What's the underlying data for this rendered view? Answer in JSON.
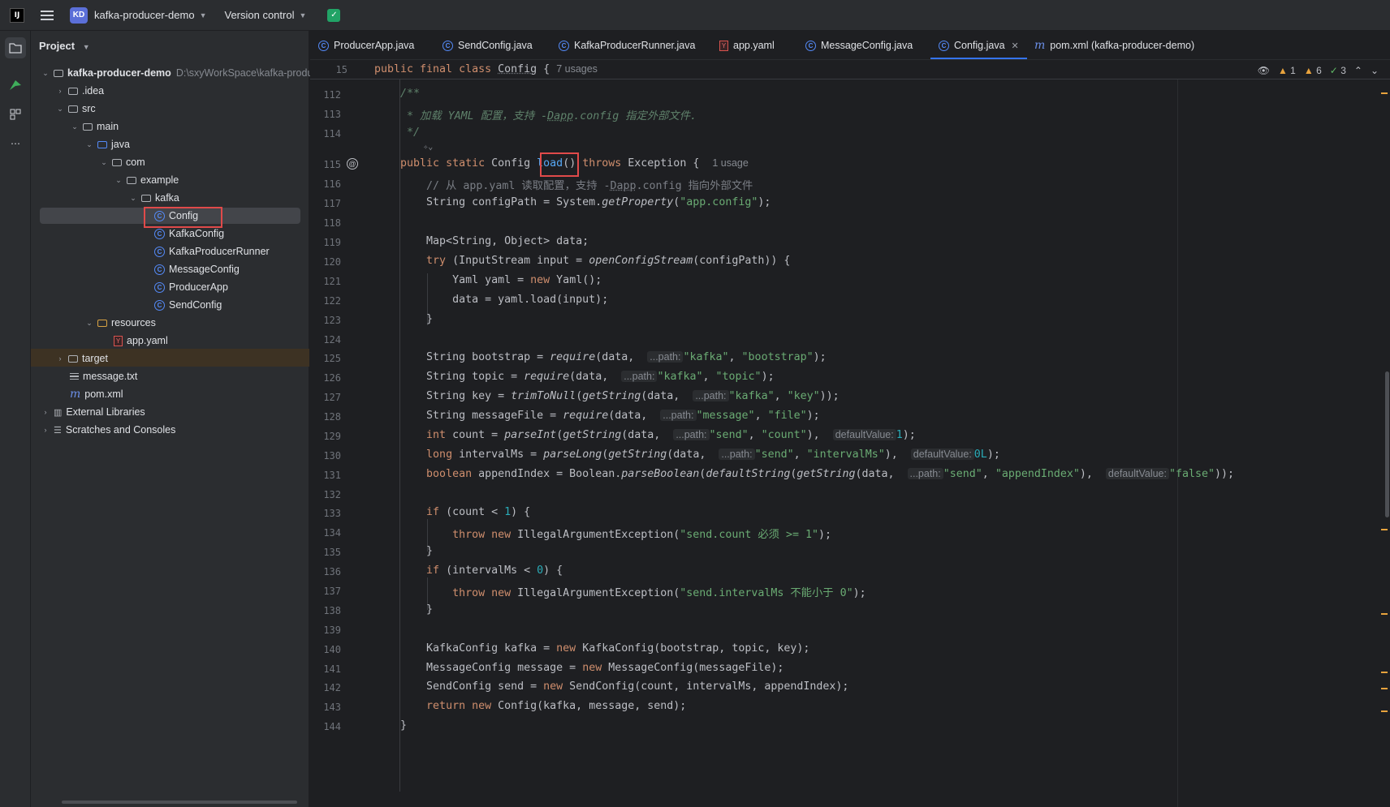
{
  "titlebar": {
    "logo": "IJ",
    "project_badge": "KD",
    "project_name": "kafka-producer-demo",
    "vcs_label": "Version control"
  },
  "project_panel": {
    "title": "Project",
    "root_name": "kafka-producer-demo",
    "root_path": "D:\\sxyWorkSpace\\kafka-produc",
    "items": {
      "idea": ".idea",
      "src": "src",
      "main": "main",
      "java": "java",
      "com": "com",
      "example": "example",
      "kafka": "kafka",
      "config": "Config",
      "kafkaconfig": "KafkaConfig",
      "runner": "KafkaProducerRunner",
      "messageconfig": "MessageConfig",
      "producerapp": "ProducerApp",
      "sendconfig": "SendConfig",
      "resources": "resources",
      "appyaml": "app.yaml",
      "target": "target",
      "messagetxt": "message.txt",
      "pomxml": "pom.xml",
      "extlibs": "External Libraries",
      "scratches": "Scratches and Consoles"
    }
  },
  "tabs": [
    {
      "label": "ProducerApp.java",
      "icon": "class-icon"
    },
    {
      "label": "SendConfig.java",
      "icon": "class-icon"
    },
    {
      "label": "KafkaProducerRunner.java",
      "icon": "class-icon"
    },
    {
      "label": "app.yaml",
      "icon": "yaml-icon"
    },
    {
      "label": "MessageConfig.java",
      "icon": "class-icon"
    },
    {
      "label": "Config.java",
      "icon": "class-icon",
      "active": true
    },
    {
      "label": "pom.xml (kafka-producer-demo)",
      "icon": "maven-icon"
    }
  ],
  "inspections": {
    "warnings_a": "1",
    "warnings_b": "6",
    "ok": "3"
  },
  "sticky": {
    "line": "15",
    "usages": "7 usages"
  },
  "code_lines": [
    {
      "n": "112"
    },
    {
      "n": "113"
    },
    {
      "n": "114"
    },
    {
      "n": "115"
    },
    {
      "n": "116"
    },
    {
      "n": "117"
    },
    {
      "n": "118"
    },
    {
      "n": "119"
    },
    {
      "n": "120"
    },
    {
      "n": "121"
    },
    {
      "n": "122"
    },
    {
      "n": "123"
    },
    {
      "n": "124"
    },
    {
      "n": "125"
    },
    {
      "n": "126"
    },
    {
      "n": "127"
    },
    {
      "n": "128"
    },
    {
      "n": "129"
    },
    {
      "n": "130"
    },
    {
      "n": "131"
    },
    {
      "n": "132"
    },
    {
      "n": "133"
    },
    {
      "n": "134"
    },
    {
      "n": "135"
    },
    {
      "n": "136"
    },
    {
      "n": "137"
    },
    {
      "n": "138"
    },
    {
      "n": "139"
    },
    {
      "n": "140"
    },
    {
      "n": "141"
    },
    {
      "n": "142"
    },
    {
      "n": "143"
    },
    {
      "n": "144"
    }
  ],
  "hints": {
    "usage_load": "1 usage",
    "path": "...path:",
    "default_value": "defaultValue:"
  },
  "colors": {
    "keyword": "#cf8e6d",
    "string": "#6aab73",
    "number": "#2aacb8",
    "accent": "#3574f0",
    "highlight_box": "#e04a4a"
  }
}
